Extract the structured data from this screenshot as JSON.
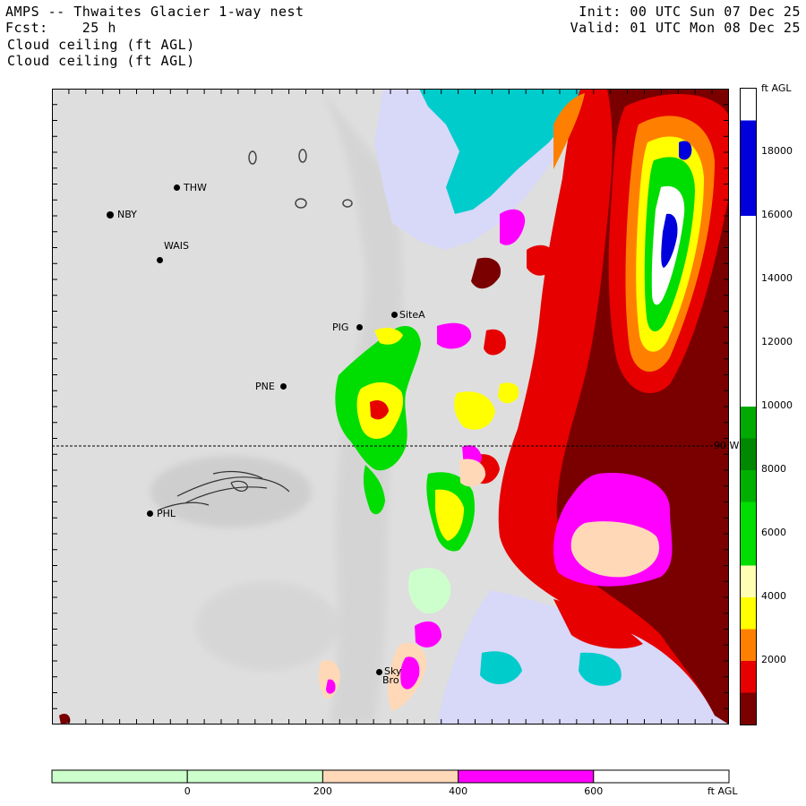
{
  "header": {
    "title": "AMPS -- Thwaites Glacier 1-way nest",
    "fcst_label": "Fcst:",
    "fcst_value": "25 h",
    "field1": "Cloud ceiling (ft AGL)",
    "field2": "Cloud ceiling (ft AGL)",
    "init": "Init: 00 UTC Sun 07 Dec 25",
    "valid": "Valid: 01 UTC Mon 08 Dec 25"
  },
  "stations": [
    {
      "name": "THW"
    },
    {
      "name": "NBY"
    },
    {
      "name": "WAIS"
    },
    {
      "name": "PIG"
    },
    {
      "name": "SiteA"
    },
    {
      "name": "PNE"
    },
    {
      "name": "PHL"
    },
    {
      "name": "Sky"
    },
    {
      "name": "Bro"
    }
  ],
  "latitude_line_label": "90 W",
  "right_colorbar": {
    "unit": "ft AGL",
    "ticks": [
      "18000",
      "16000",
      "14000",
      "12000",
      "10000",
      "8000",
      "6000",
      "4000",
      "2000"
    ],
    "bins": [
      {
        "lower": 0,
        "upper": 1000,
        "color": "#7a0000"
      },
      {
        "lower": 1000,
        "upper": 2000,
        "color": "#e60000"
      },
      {
        "lower": 2000,
        "upper": 3000,
        "color": "#ff8000"
      },
      {
        "lower": 3000,
        "upper": 4000,
        "color": "#ffff00"
      },
      {
        "lower": 4000,
        "upper": 5000,
        "color": "#ffffb4"
      },
      {
        "lower": 5000,
        "upper": 7000,
        "color": "#00dd00"
      },
      {
        "lower": 7000,
        "upper": 8000,
        "color": "#00b000"
      },
      {
        "lower": 8000,
        "upper": 9000,
        "color": "#008800"
      },
      {
        "lower": 9000,
        "upper": 10000,
        "color": "#00aa00"
      },
      {
        "lower": 10000,
        "upper": 16000,
        "color": "#ffffff"
      },
      {
        "lower": 16000,
        "upper": 19000,
        "color": "#0000dd"
      },
      {
        "lower": 19000,
        "upper": 20000,
        "color": "#ffffff"
      }
    ]
  },
  "bottom_colorbar": {
    "unit": "ft AGL",
    "ticks": [
      "0",
      "200",
      "400",
      "600"
    ],
    "bins": [
      {
        "color": "#ccffcc"
      },
      {
        "color": "#ccffcc"
      },
      {
        "color": "#ffd8b8"
      },
      {
        "color": "#ff00ff"
      },
      {
        "color": "#ffffff"
      }
    ]
  },
  "colors": {
    "terrain": "#dedede",
    "sea_ice": "#00cccc",
    "pale_blue": "#d8d8f8"
  }
}
